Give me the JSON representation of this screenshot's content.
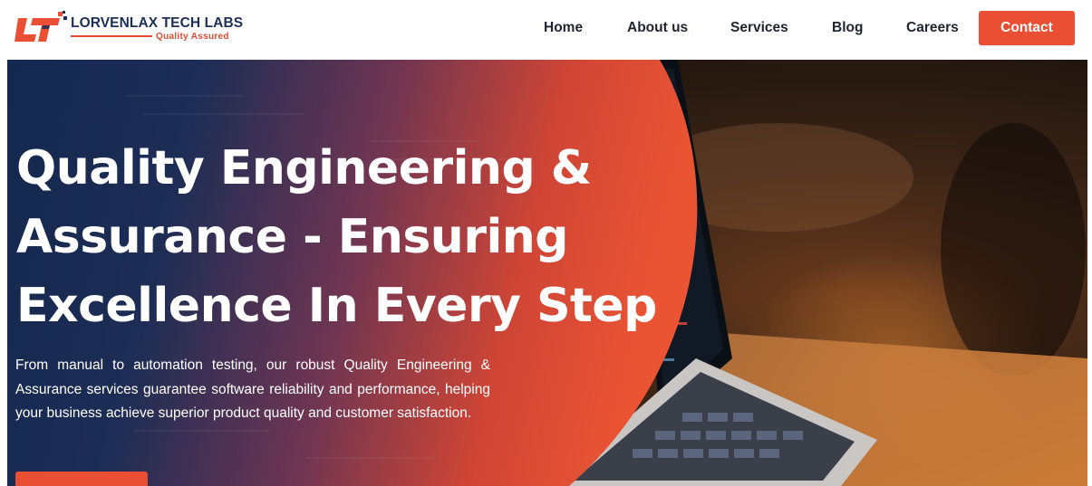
{
  "brand": {
    "name": "LORVENLAX TECH LABS",
    "tagline": "Quality Assured",
    "logo_mark": "LT",
    "primary_color": "#ea4f34",
    "navy_color": "#1b2f57"
  },
  "nav": {
    "items": [
      {
        "label": "Home"
      },
      {
        "label": "About us"
      },
      {
        "label": "Services"
      },
      {
        "label": "Blog"
      },
      {
        "label": "Careers"
      }
    ],
    "contact_label": "Contact"
  },
  "hero": {
    "title_lines": [
      "Quality Engineering &",
      "Assurance - Ensuring",
      "Excellence In Every Step"
    ],
    "description": "From manual to automation testing, our robust Quality Engineering & Assurance services guarantee software reliability and performance, helping your business achieve superior product quality and customer satisfaction."
  }
}
